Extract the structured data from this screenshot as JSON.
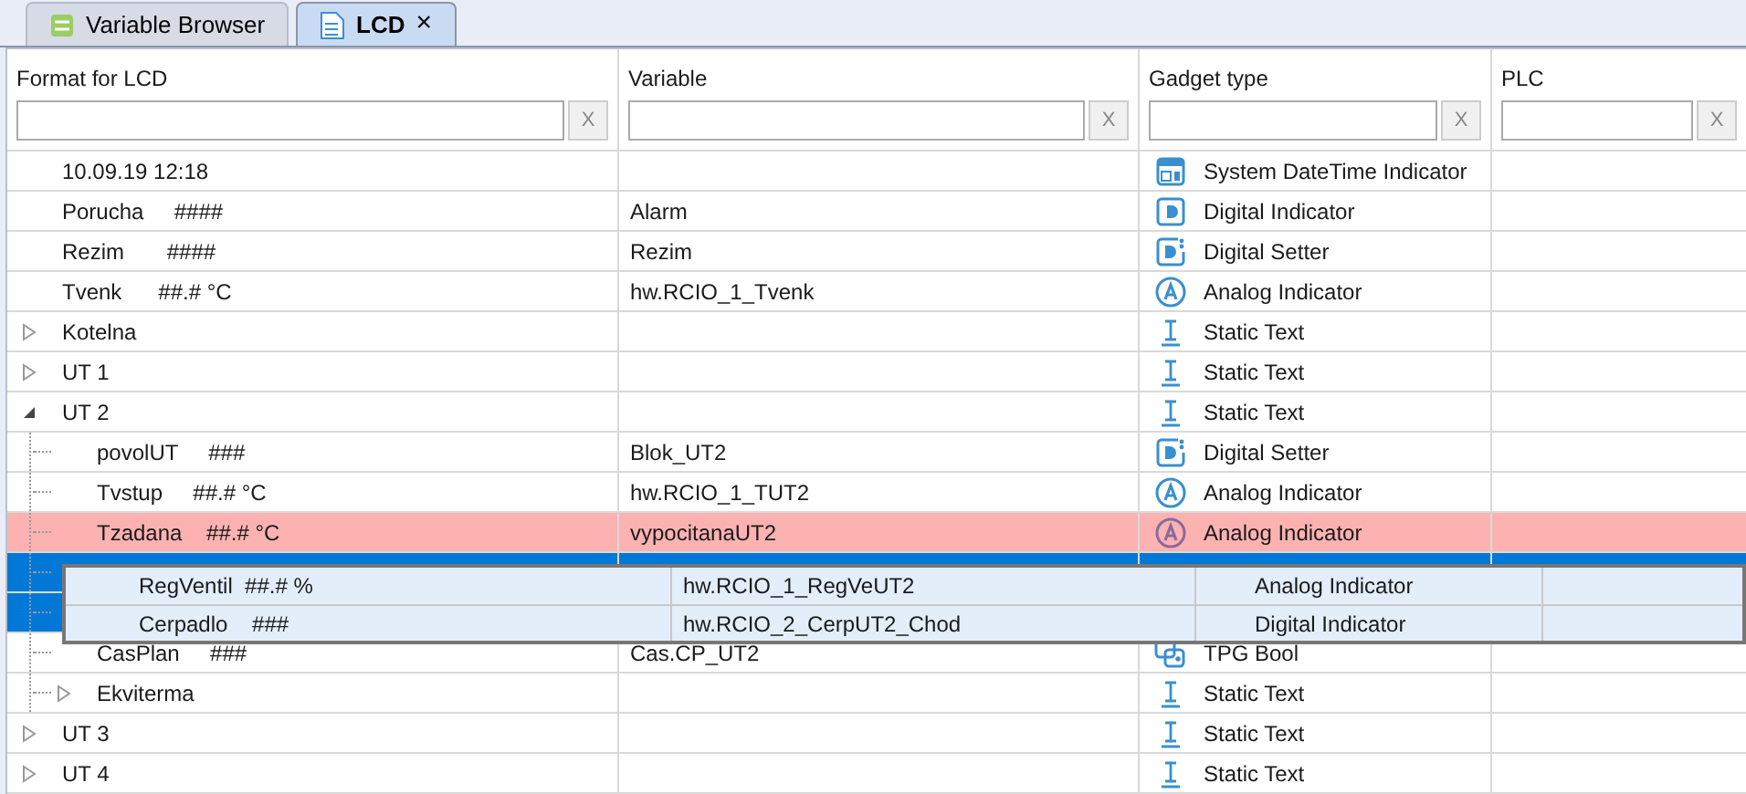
{
  "tabs": [
    {
      "label": "Variable Browser",
      "selected": false,
      "kind": "variables"
    },
    {
      "label": "LCD",
      "selected": true,
      "kind": "document",
      "close": "×"
    }
  ],
  "table": {
    "columns": [
      {
        "label": "Format for LCD",
        "clear": "X"
      },
      {
        "label": "Variable",
        "clear": "X"
      },
      {
        "label": "Gadget type",
        "clear": "X"
      },
      {
        "label": "PLC",
        "clear": "X"
      }
    ],
    "rows": [
      {
        "kind": "item",
        "format": "10.09.19 12:18",
        "gadget": {
          "label": "System DateTime Indicator",
          "kind": "datetime"
        },
        "selected": false
      },
      {
        "kind": "item",
        "format": "Porucha     ####",
        "variable": "Alarm",
        "gadget": {
          "label": "Digital Indicator",
          "kind": "digital"
        },
        "selected": false
      },
      {
        "kind": "item",
        "format": "Rezim       ####",
        "variable": "Rezim",
        "gadget": {
          "label": "Digital Setter",
          "kind": "setter"
        },
        "selected": false
      },
      {
        "kind": "item",
        "format": "Tvenk      ##.# °C",
        "variable": "hw.RCIO_1_Tvenk",
        "gadget": {
          "label": "Analog Indicator",
          "kind": "analog"
        },
        "selected": false
      },
      {
        "kind": "group",
        "expanded": false,
        "format": "Kotelna",
        "gadget": {
          "label": "Static Text",
          "kind": "text"
        },
        "selected": false
      },
      {
        "kind": "group",
        "expanded": false,
        "format": "UT 1",
        "gadget": {
          "label": "Static Text",
          "kind": "text"
        },
        "selected": false
      },
      {
        "kind": "group",
        "expanded": true,
        "format": "UT 2",
        "gadget": {
          "label": "Static Text",
          "kind": "text"
        },
        "selected": false,
        "children": [
          {
            "kind": "item",
            "format": "povolUT     ###",
            "variable": "Blok_UT2",
            "gadget": {
              "label": "Digital Setter",
              "kind": "setter"
            },
            "selected": false
          },
          {
            "kind": "item",
            "format": "Tvstup     ##.# °C",
            "variable": "hw.RCIO_1_TUT2",
            "gadget": {
              "label": "Analog Indicator",
              "kind": "analog"
            },
            "selected": false
          },
          {
            "kind": "item",
            "format": "Tzadana    ##.# °C",
            "variable": "vypocitanaUT2",
            "gadget": {
              "label": "Analog Indicator",
              "kind": "analog"
            },
            "selected": false,
            "color": "#fdb2b2"
          },
          {
            "kind": "item",
            "selected": true
          },
          {
            "kind": "item",
            "selected": true
          },
          {
            "kind": "item",
            "format": "CasPlan     ###",
            "variable": "Cas.CP_UT2",
            "gadget": {
              "label": "TPG Bool",
              "kind": "bool"
            },
            "selected": false
          },
          {
            "kind": "group",
            "expanded": false,
            "format": "Ekviterma",
            "gadget": {
              "label": "Static Text",
              "kind": "text"
            },
            "selected": false
          }
        ]
      },
      {
        "kind": "group",
        "expanded": false,
        "format": "UT 3",
        "gadget": {
          "label": "Static Text",
          "kind": "text"
        },
        "selected": false
      },
      {
        "kind": "group",
        "expanded": false,
        "format": "UT 4",
        "gadget": {
          "label": "Static Text",
          "kind": "text"
        },
        "selected": false
      }
    ]
  },
  "drag_preview": {
    "rows": [
      {
        "format": "RegVentil  ##.# %",
        "variable": "hw.RCIO_1_RegVeUT2",
        "gadget": "Analog Indicator"
      },
      {
        "format": "Cerpadlo    ###",
        "variable": "hw.RCIO_2_CerpUT2_Chod",
        "gadget": "Digital Indicator"
      }
    ]
  }
}
